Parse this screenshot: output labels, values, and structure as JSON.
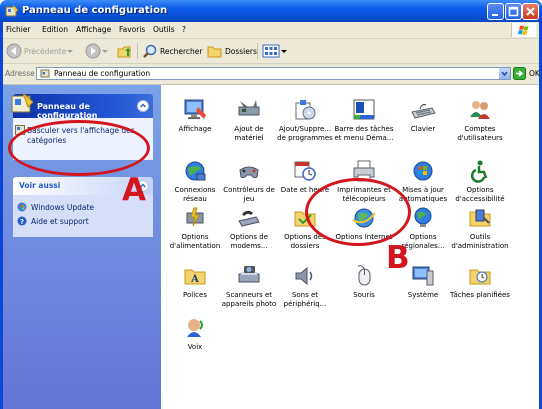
{
  "window": {
    "title": "Panneau de configuration"
  },
  "menu": [
    {
      "label": "Fichier"
    },
    {
      "label": "Edition"
    },
    {
      "label": "Affichage"
    },
    {
      "label": "Favoris"
    },
    {
      "label": "Outils"
    },
    {
      "label": "?"
    }
  ],
  "toolbar": {
    "back": "Précédente",
    "search": "Rechercher",
    "folders": "Dossiers"
  },
  "address": {
    "label": "Adresse",
    "value": "Panneau de configuration",
    "go": "OK"
  },
  "left_pane": {
    "panel1": {
      "title": "Panneau de configuration",
      "link": "Basculer vers l'affichage des catégories"
    },
    "panel2": {
      "title": "Voir aussi",
      "links": [
        "Windows Update",
        "Aide et support"
      ]
    }
  },
  "items": [
    {
      "label": "Affichage",
      "icon": "display-icon"
    },
    {
      "label": "Ajout de matériel",
      "icon": "add-hardware-icon"
    },
    {
      "label": "Ajout/Suppre... de programmes",
      "icon": "add-remove-programs-icon"
    },
    {
      "label": "Barre des tâches et menu Déma...",
      "icon": "taskbar-icon"
    },
    {
      "label": "Clavier",
      "icon": "keyboard-icon"
    },
    {
      "label": "Comptes d'utilisateurs",
      "icon": "user-accounts-icon"
    },
    {
      "label": "Connexions réseau",
      "icon": "network-icon"
    },
    {
      "label": "Contrôleurs de jeu",
      "icon": "game-controller-icon"
    },
    {
      "label": "Date et heure",
      "icon": "clock-icon"
    },
    {
      "label": "Imprimantes et télécopieurs",
      "icon": "printer-icon"
    },
    {
      "label": "Mises à jour automatiques",
      "icon": "update-icon"
    },
    {
      "label": "Options d'accessibilité",
      "icon": "accessibility-icon"
    },
    {
      "label": "Options d'alimentation",
      "icon": "power-icon"
    },
    {
      "label": "Options de modems...",
      "icon": "modem-icon"
    },
    {
      "label": "Options des dossiers",
      "icon": "folder-options-icon"
    },
    {
      "label": "Options Internet",
      "icon": "internet-options-icon"
    },
    {
      "label": "Options régionales...",
      "icon": "regional-icon"
    },
    {
      "label": "Outils d'administration",
      "icon": "admin-tools-icon"
    },
    {
      "label": "Polices",
      "icon": "fonts-icon"
    },
    {
      "label": "Scanneurs et appareils photo",
      "icon": "scanner-icon"
    },
    {
      "label": "Sons et périphériq...",
      "icon": "sound-icon"
    },
    {
      "label": "Souris",
      "icon": "mouse-icon"
    },
    {
      "label": "Système",
      "icon": "system-icon"
    },
    {
      "label": "Tâches planifiées",
      "icon": "scheduled-tasks-icon"
    },
    {
      "label": "Voix",
      "icon": "speech-icon"
    }
  ],
  "annotations": {
    "a": "A",
    "b": "B"
  }
}
